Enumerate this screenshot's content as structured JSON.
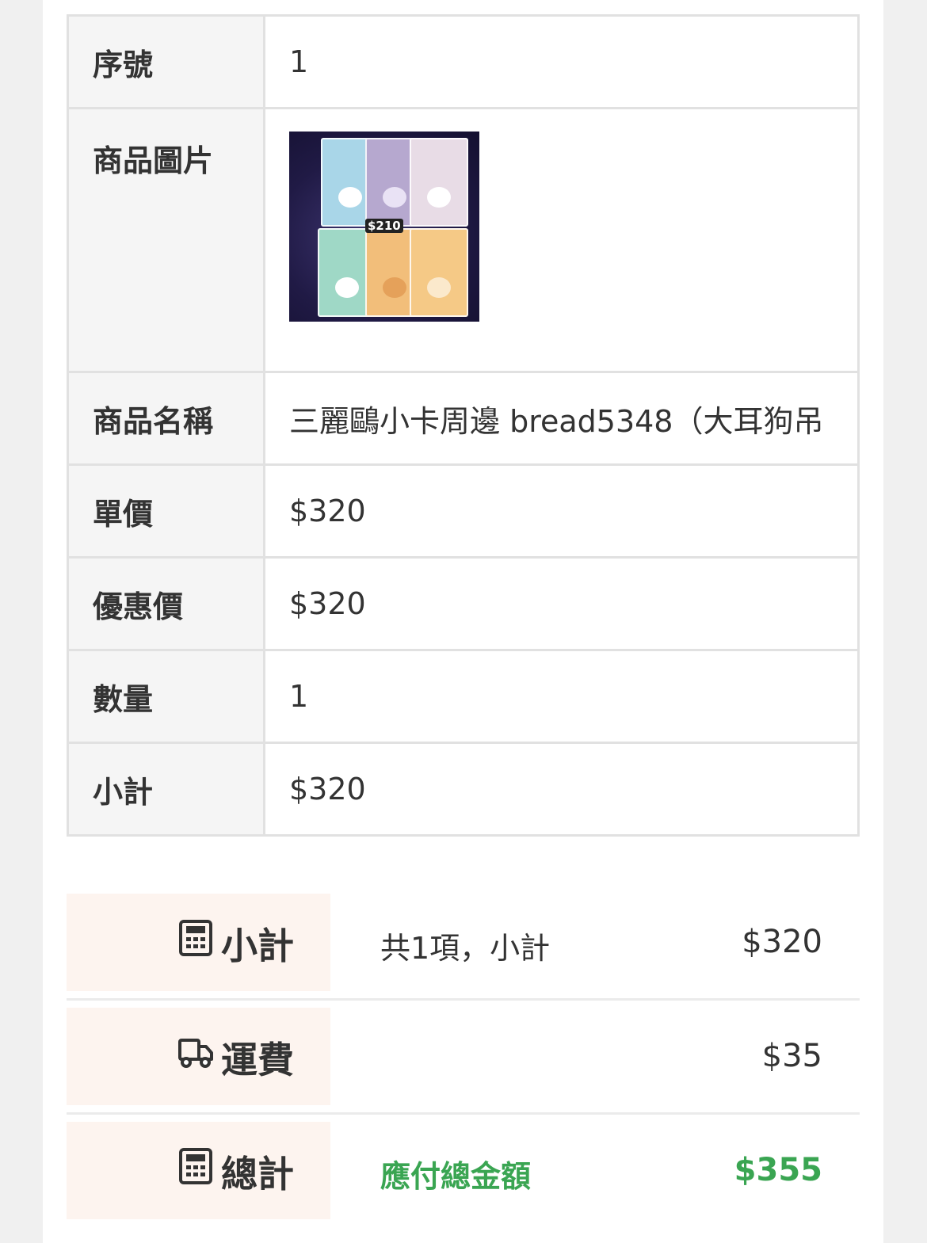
{
  "detail_rows": [
    {
      "label": "序號",
      "value": "1"
    },
    {
      "label": "商品圖片",
      "value": ""
    },
    {
      "label": "商品名稱",
      "value": "三麗鷗小卡周邊 bread5348（大耳狗吊"
    },
    {
      "label": "單價",
      "value": "$320"
    },
    {
      "label": "優惠價",
      "value": "$320"
    },
    {
      "label": "數量",
      "value": "1"
    },
    {
      "label": "小計",
      "value": "$320"
    }
  ],
  "product_image": {
    "price_tag": "$210"
  },
  "summary": {
    "subtotal": {
      "title": "小計",
      "icon": "calculator-icon",
      "desc": "共1項，小計",
      "amount": "$320"
    },
    "shipping": {
      "title": "運費",
      "icon": "truck-icon",
      "desc": "",
      "amount": "$35"
    },
    "total": {
      "title": "總計",
      "icon": "calculator-icon",
      "desc": "應付總金額",
      "amount": "$355"
    }
  },
  "colors": {
    "accent_green": "#3aa552",
    "summary_head_bg": "#fdf4ef",
    "label_bg": "#f5f5f5"
  }
}
